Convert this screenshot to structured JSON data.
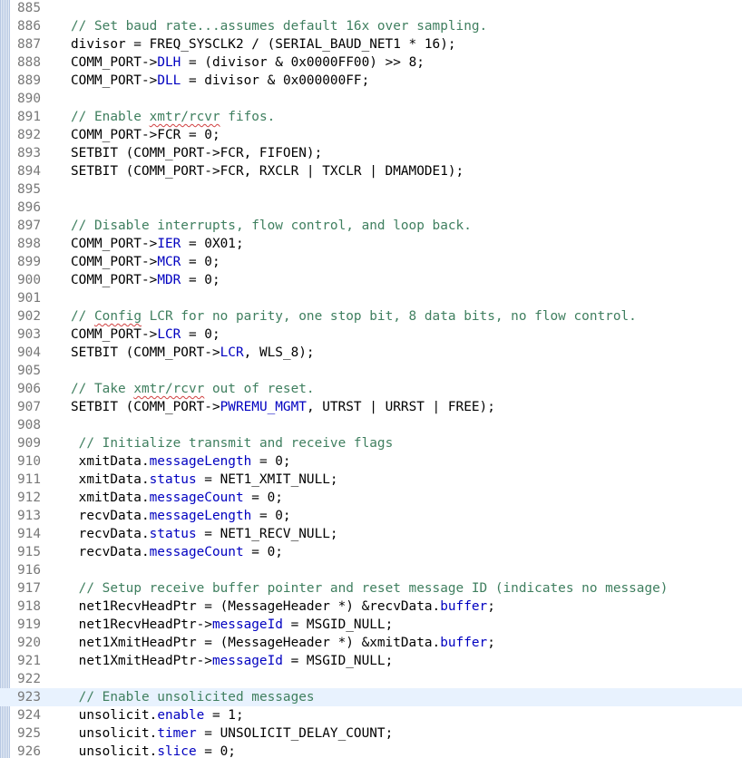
{
  "editor": {
    "current_line": "923",
    "lines": [
      {
        "num": "885",
        "text": ""
      },
      {
        "num": "886",
        "text": "// Set baud rate...assumes default 16x over sampling."
      },
      {
        "num": "887",
        "text": "divisor = FREQ_SYSCLK2 / (SERIAL_BAUD_NET1 * 16);"
      },
      {
        "num": "888",
        "text": "COMM_PORT->DLH = (divisor & 0x0000FF00) >> 8;"
      },
      {
        "num": "889",
        "text": "COMM_PORT->DLL = divisor & 0x000000FF;"
      },
      {
        "num": "890",
        "text": ""
      },
      {
        "num": "891",
        "text": "// Enable xmtr/rcvr fifos."
      },
      {
        "num": "892",
        "text": "COMM_PORT->FCR = 0;"
      },
      {
        "num": "893",
        "text": "SETBIT (COMM_PORT->FCR, FIFOEN);"
      },
      {
        "num": "894",
        "text": "SETBIT (COMM_PORT->FCR, RXCLR | TXCLR | DMAMODE1);"
      },
      {
        "num": "895",
        "text": ""
      },
      {
        "num": "896",
        "text": ""
      },
      {
        "num": "897",
        "text": "// Disable interrupts, flow control, and loop back."
      },
      {
        "num": "898",
        "text": "COMM_PORT->IER = 0X01;"
      },
      {
        "num": "899",
        "text": "COMM_PORT->MCR = 0;"
      },
      {
        "num": "900",
        "text": "COMM_PORT->MDR = 0;"
      },
      {
        "num": "901",
        "text": ""
      },
      {
        "num": "902",
        "text": "// Config LCR for no parity, one stop bit, 8 data bits, no flow control."
      },
      {
        "num": "903",
        "text": "COMM_PORT->LCR = 0;"
      },
      {
        "num": "904",
        "text": "SETBIT (COMM_PORT->LCR, WLS_8);"
      },
      {
        "num": "905",
        "text": ""
      },
      {
        "num": "906",
        "text": "// Take xmtr/rcvr out of reset."
      },
      {
        "num": "907",
        "text": "SETBIT (COMM_PORT->PWREMU_MGMT, UTRST | URRST | FREE);"
      },
      {
        "num": "908",
        "text": ""
      },
      {
        "num": "909",
        "text": " // Initialize transmit and receive flags"
      },
      {
        "num": "910",
        "text": " xmitData.messageLength = 0;"
      },
      {
        "num": "911",
        "text": " xmitData.status = NET1_XMIT_NULL;"
      },
      {
        "num": "912",
        "text": " xmitData.messageCount = 0;"
      },
      {
        "num": "913",
        "text": " recvData.messageLength = 0;"
      },
      {
        "num": "914",
        "text": " recvData.status = NET1_RECV_NULL;"
      },
      {
        "num": "915",
        "text": " recvData.messageCount = 0;"
      },
      {
        "num": "916",
        "text": ""
      },
      {
        "num": "917",
        "text": " // Setup receive buffer pointer and reset message ID (indicates no message)"
      },
      {
        "num": "918",
        "text": " net1RecvHeadPtr = (MessageHeader *) &recvData.buffer;"
      },
      {
        "num": "919",
        "text": " net1RecvHeadPtr->messageId = MSGID_NULL;"
      },
      {
        "num": "920",
        "text": " net1XmitHeadPtr = (MessageHeader *) &xmitData.buffer;"
      },
      {
        "num": "921",
        "text": " net1XmitHeadPtr->messageId = MSGID_NULL;"
      },
      {
        "num": "922",
        "text": ""
      },
      {
        "num": "923",
        "text": " // Enable unsolicited messages"
      },
      {
        "num": "924",
        "text": " unsolicit.enable = 1;"
      },
      {
        "num": "925",
        "text": " unsolicit.timer = UNSOLICIT_DELAY_COUNT;"
      },
      {
        "num": "926",
        "text": " unsolicit.slice = 0;"
      }
    ]
  },
  "colors": {
    "comment": "#3f7f5f",
    "field": "#0000c0",
    "line_number": "#787878",
    "current_line_bg": "#e8f2fe",
    "gutter_stripe": "#b7c8e2"
  }
}
